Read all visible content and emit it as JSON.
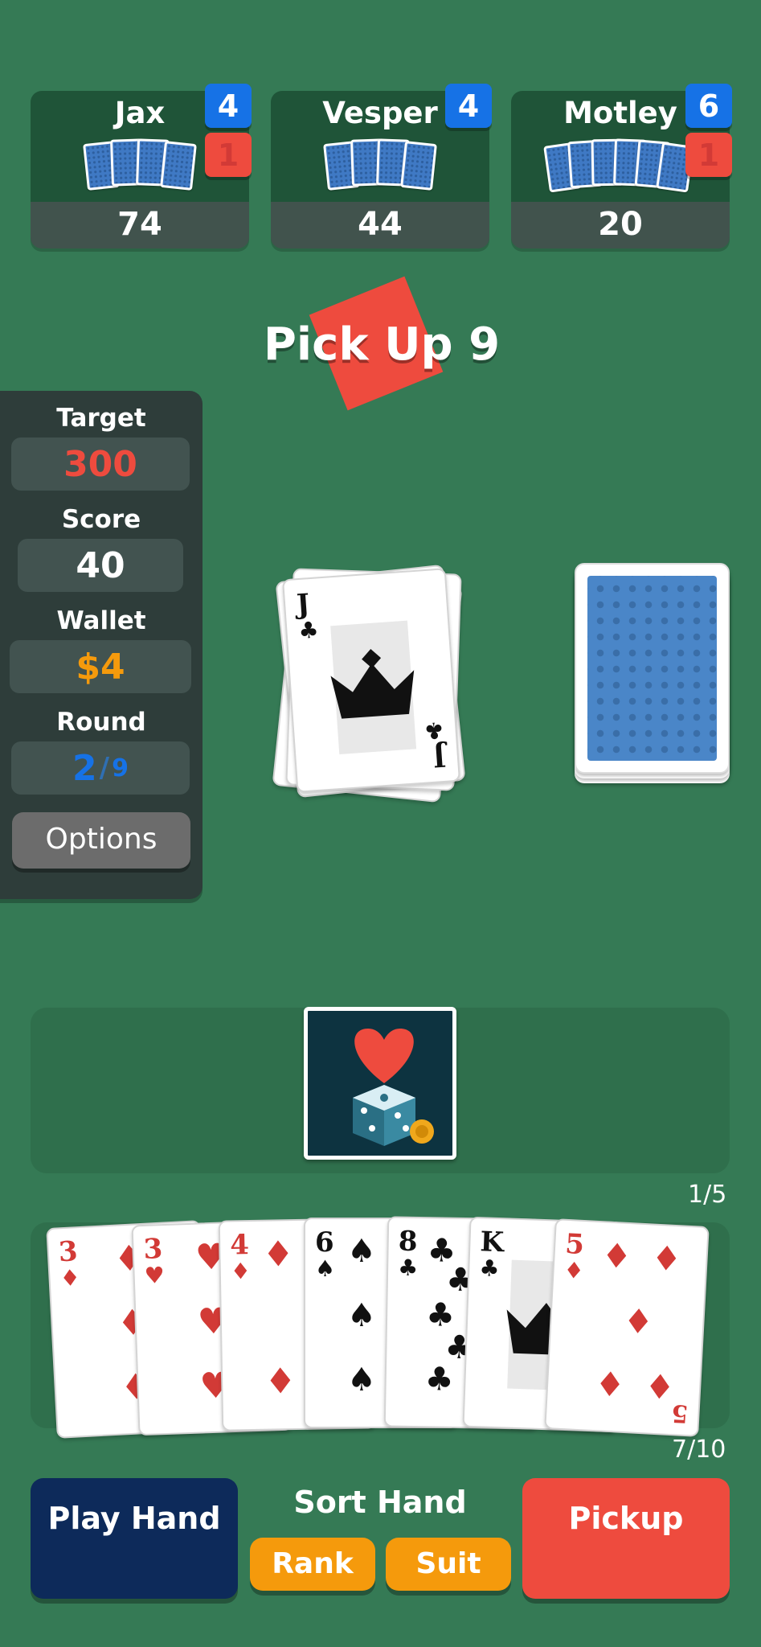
{
  "opponents": [
    {
      "name": "Jax",
      "score": "74",
      "cards_badge": "4",
      "red_badge": "1"
    },
    {
      "name": "Vesper",
      "score": "44",
      "cards_badge": "4"
    },
    {
      "name": "Motley",
      "score": "20",
      "cards_badge": "6",
      "red_badge": "1"
    }
  ],
  "banner": "Pick Up 9",
  "panel": {
    "target_label": "Target",
    "target_value": "300",
    "score_label": "Score",
    "score_value": "40",
    "wallet_label": "Wallet",
    "wallet_value": "$4",
    "round_label": "Round",
    "round_current": "2",
    "round_sep": "/",
    "round_total": "9",
    "options_label": "Options"
  },
  "discard_top": {
    "rank": "J",
    "suit": "♣"
  },
  "joker_counter": "1/5",
  "hand_counter": "7/10",
  "hand": [
    {
      "rank": "3",
      "suit": "♦",
      "color": "red"
    },
    {
      "rank": "3",
      "suit": "♥",
      "color": "red"
    },
    {
      "rank": "4",
      "suit": "♦",
      "color": "red"
    },
    {
      "rank": "6",
      "suit": "♠",
      "color": "black"
    },
    {
      "rank": "8",
      "suit": "♣",
      "color": "black"
    },
    {
      "rank": "K",
      "suit": "♣",
      "color": "black"
    },
    {
      "rank": "5",
      "suit": "♦",
      "color": "red"
    }
  ],
  "controls": {
    "play_hand": "Play Hand",
    "sort_label": "Sort Hand",
    "sort_rank": "Rank",
    "sort_suit": "Suit",
    "pickup": "Pickup"
  },
  "colors": {
    "table": "#357a55",
    "red_accent": "#ee4b3e",
    "blue_accent": "#1672e6",
    "orange": "#f59a0c",
    "navy": "#0d2a5a"
  }
}
